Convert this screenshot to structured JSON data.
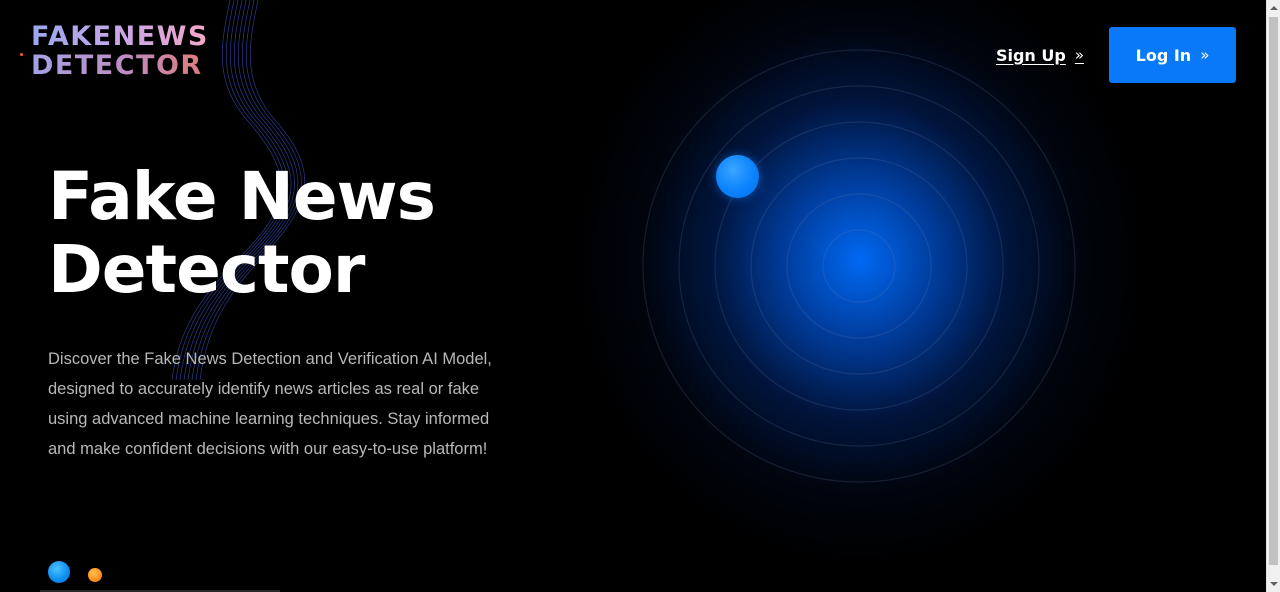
{
  "logo": {
    "line1": "FAKENEWS",
    "line2": "DETECTOR"
  },
  "nav": {
    "signup_label": "Sign Up",
    "login_label": "Log In",
    "chevron_glyph": "»"
  },
  "hero": {
    "title_line1": "Fake News",
    "title_line2": "Detector",
    "description": "Discover the Fake News Detection and Verification AI Model, designed to accurately identify news articles as real or fake using advanced machine learning techniques. Stay informed and make confident decisions with our easy-to-use platform!"
  },
  "colors": {
    "background": "#000000",
    "accent_blue": "#0a79f8",
    "accent_orange": "#ff8a1c",
    "text_muted": "#b8b8b8"
  },
  "icons": {
    "signup_chevron": "double-chevron-right-icon",
    "login_chevron": "double-chevron-right-icon"
  }
}
